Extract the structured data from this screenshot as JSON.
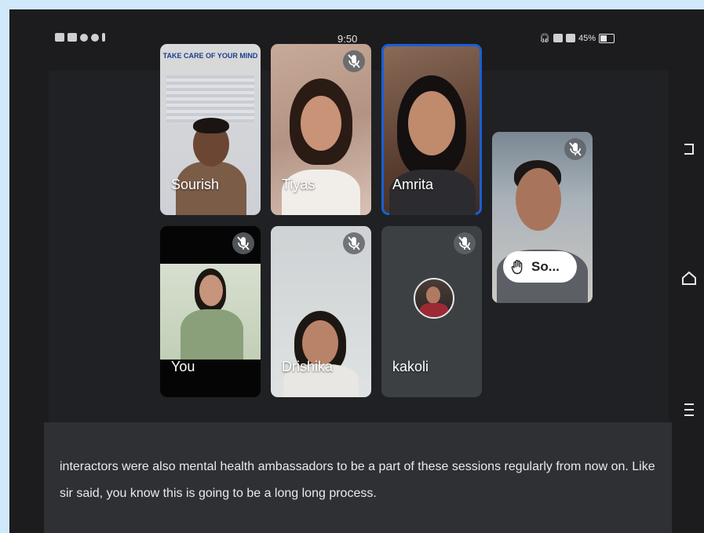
{
  "status_bar": {
    "time": "9:50",
    "battery": "45%"
  },
  "participants": [
    {
      "name": "Sourish",
      "muted": false,
      "active": false,
      "poster_title": "TAKE CARE OF YOUR MIND"
    },
    {
      "name": "Tiyas",
      "muted": true,
      "active": false
    },
    {
      "name": "Amrita",
      "muted": false,
      "active": true
    },
    {
      "name": "You",
      "muted": true,
      "active": false
    },
    {
      "name": "Drishika",
      "muted": true,
      "active": false
    },
    {
      "name": "kakoli",
      "muted": true,
      "active": false
    },
    {
      "name": "",
      "muted": true,
      "active": false,
      "raised_hand_label": "So..."
    }
  ],
  "nav_buttons": [
    "back-icon",
    "home-icon",
    "menu-icon"
  ],
  "caption": {
    "text": "interactors were also mental health ambassadors to be a part of these sessions regularly from now on. Like sir said, you know this is going to be a long long process."
  },
  "colors": {
    "active_speaker_border": "#1a5fd6",
    "stage_bg": "#202124",
    "caption_bg": "#2f3033"
  }
}
